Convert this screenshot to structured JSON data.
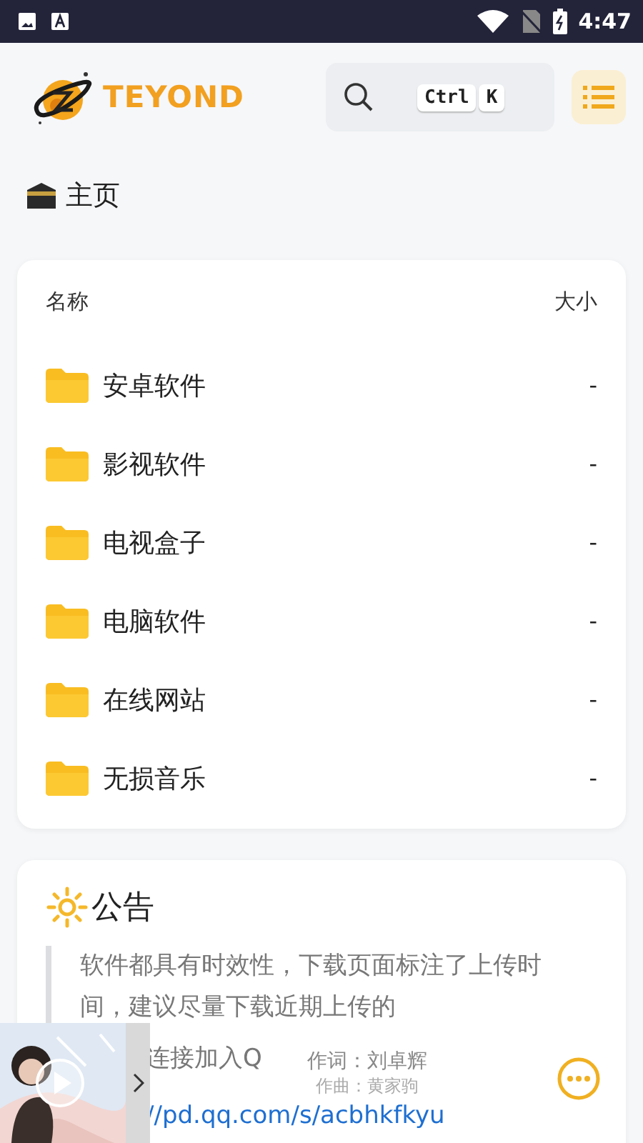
{
  "status_bar": {
    "time": "4:47"
  },
  "header": {
    "logo_text": "TEYOND",
    "search": {
      "keys": [
        "Ctrl",
        "K"
      ]
    }
  },
  "breadcrumb": {
    "label": "主页"
  },
  "file_list": {
    "columns": [
      "名称",
      "大小"
    ],
    "rows": [
      {
        "name": "安卓软件",
        "size": "-"
      },
      {
        "name": "影视软件",
        "size": "-"
      },
      {
        "name": "电视盒子",
        "size": "-"
      },
      {
        "name": "电脑软件",
        "size": "-"
      },
      {
        "name": "在线网站",
        "size": "-"
      },
      {
        "name": "无损音乐",
        "size": "-"
      }
    ]
  },
  "notice": {
    "title": "公告",
    "quote": "软件都具有时效性，下载页面标注了上传时间，建议尽量下载近期上传的",
    "line": "连接加入Q",
    "link": "//pd.qq.com/s/acbhkfkyu"
  },
  "music_player": {
    "lyric_lines": [
      "作词：刘卓辉",
      "作曲：黄家驹"
    ]
  }
}
